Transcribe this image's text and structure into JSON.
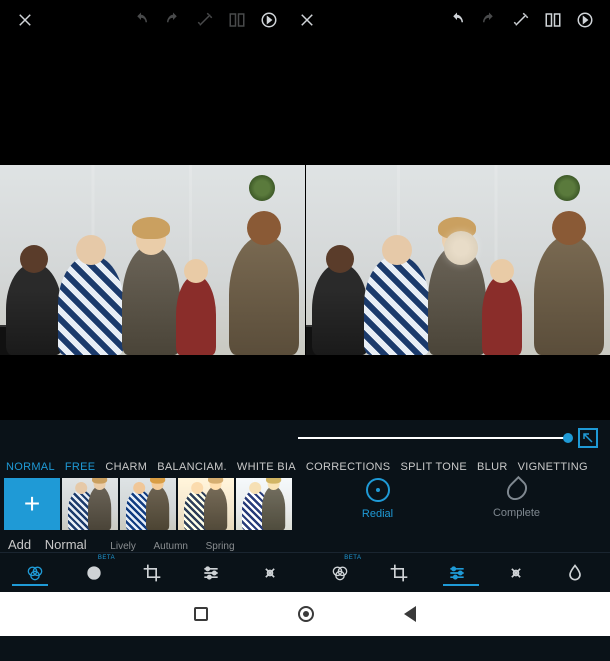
{
  "toolbar": {
    "close": "✕",
    "undo": "undo",
    "redo": "redo",
    "wand": "auto",
    "compare": "compare",
    "next": "next"
  },
  "slider": {
    "value": 100,
    "max": 100
  },
  "categories": [
    {
      "label": "NORMAL",
      "active": true
    },
    {
      "label": "FREE",
      "active": true
    },
    {
      "label": "CHARM",
      "active": false
    },
    {
      "label": "BALANCIAM.",
      "active": false
    },
    {
      "label": "WHITE BIA",
      "active": false
    },
    {
      "label": "CORRECTIONS",
      "active": false
    },
    {
      "label": "SPLIT TONE",
      "active": false
    },
    {
      "label": "BLUR",
      "active": false
    },
    {
      "label": "VIGNETTING",
      "active": false
    }
  ],
  "presets": {
    "add": "+",
    "row_label": "Add",
    "items": [
      {
        "label": "Normal"
      },
      {
        "label": "Lively"
      },
      {
        "label": "Autumn"
      },
      {
        "label": "Spring"
      }
    ]
  },
  "modes": {
    "redial": "Redial",
    "complete": "Complete"
  },
  "tooltabs": {
    "left_selected": 0,
    "right_selected": 3,
    "beta": "BETA"
  }
}
